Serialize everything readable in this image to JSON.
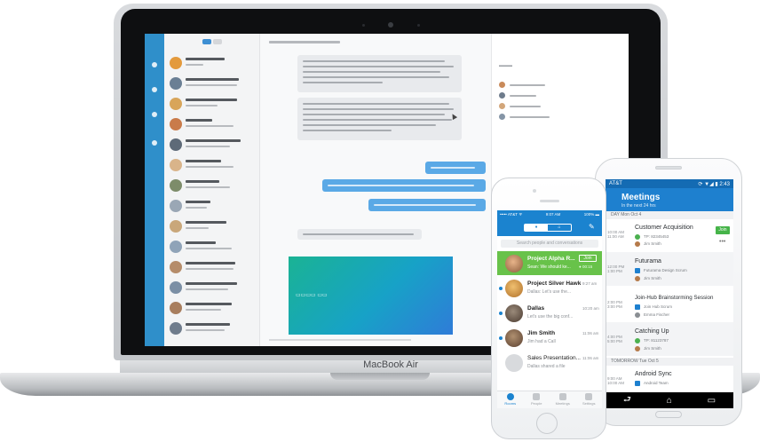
{
  "laptop": {
    "brand_label": "MacBook Air",
    "conversation_avatar_colors": [
      "#e39a3c",
      "#6a7f94",
      "#d8a55a",
      "#c97b4a",
      "#5e6a78",
      "#d9b48a",
      "#7d8c6a",
      "#9aa7b5",
      "#c9a77a",
      "#8fa3b8",
      "#b58c6a",
      "#7b8fa5",
      "#a87e5e",
      "#6f7c8c"
    ]
  },
  "iphone": {
    "status": {
      "carrier": "••••• AT&T ᯤ",
      "time": "9:07 AM",
      "battery": "100% ▬"
    },
    "segments": [
      "♦",
      "⌂"
    ],
    "search_placeholder": "Search people and conversations",
    "rows": [
      {
        "name": "Project Alpha R...",
        "preview": "Sean: We should ke...",
        "time": "",
        "join": "Join",
        "meta": "● 00:15",
        "selected": true
      },
      {
        "name": "Project Silver Hawk",
        "preview": "Dallas: Let's use the...",
        "time": "9:27 am"
      },
      {
        "name": "Dallas",
        "preview": "Let's use the big conf...",
        "time": "10:20 am"
      },
      {
        "name": "Jim Smith",
        "preview": "Jim had a Call",
        "time": "11:06 am"
      },
      {
        "name": "Sales Presentation...",
        "preview": "Dallas shared a file",
        "time": "11:06 am"
      }
    ],
    "tabs": [
      "Rooms",
      "People",
      "Meetings",
      "Settings"
    ]
  },
  "android": {
    "status": {
      "carrier": "AT&T",
      "icons": "⟳ ▼◢ ▮ 2:43"
    },
    "title": "Meetings",
    "subtitle": "In the next 24 hrs",
    "day1": "DAY   Mon Oct 4",
    "day2": "TOMORROW   Tue Oct 5",
    "items": [
      {
        "time": "10:00 AM\n11:00 AM",
        "name": "Customer Acquisition",
        "line1": "TP: 82345453",
        "line2": "Jim Smith",
        "join": "Join",
        "more": "•••"
      },
      {
        "time": "12:00 PM\n1:00 PM",
        "name": "Futurama",
        "line1": "Futurama Design Scrum",
        "line2": "Jim Smith"
      },
      {
        "time": "2:00 PM\n3:00 PM",
        "name": "Join-Hub Brainstorming Session",
        "line1": "Join Hub Scrum",
        "line2": "Emma Fischer"
      },
      {
        "time": "4:00 PM\n5:00 PM",
        "name": "Catching Up",
        "line1": "TP: 81123787",
        "line2": "Jim Smith"
      },
      {
        "time": "9:00 AM\n10:00 AM",
        "name": "Android Sync",
        "line1": "Android Team"
      }
    ],
    "nav": [
      "⮐",
      "⌂",
      "▭"
    ]
  }
}
